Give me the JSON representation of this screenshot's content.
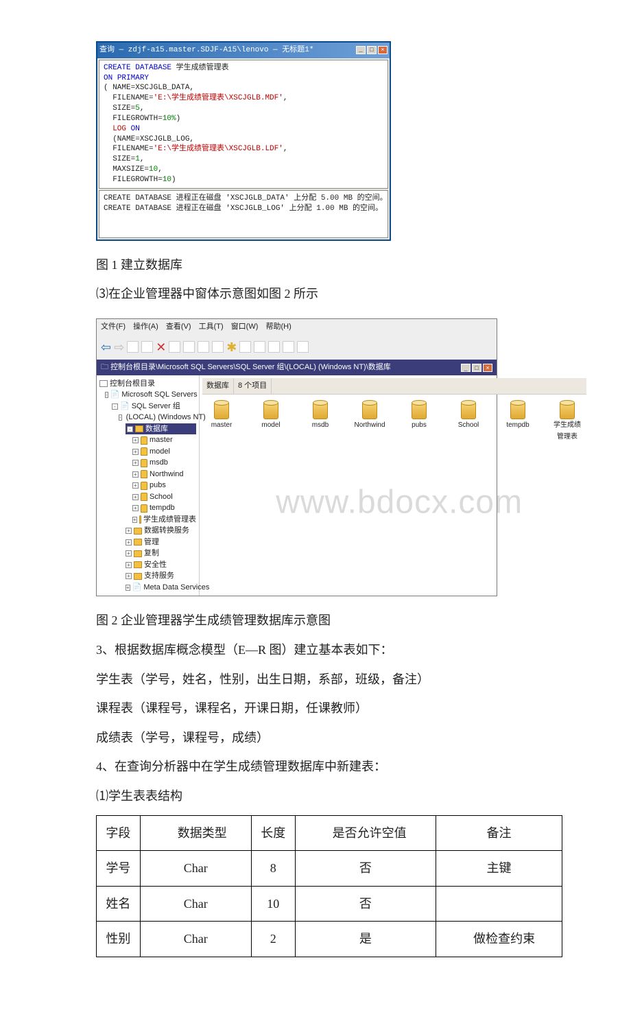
{
  "win1": {
    "title": "查询 — zdjf-a15.master.SDJF-A15\\lenovo — 无标题1*",
    "code": {
      "l1a": "CREATE",
      "l1b": "DATABASE",
      "l1c": "学生成绩管理表",
      "l2a": "ON",
      "l2b": "PRIMARY",
      "l3a": "( NAME=",
      "l3b": "XSCJGLB_DATA,",
      "l4a": "  FILENAME=",
      "l4b": "'E:\\学生成绩管理表\\XSCJGLB.MDF'",
      "l4c": ",",
      "l5a": "  SIZE=",
      "l5b": "5",
      "l5c": ",",
      "l6a": "  FILEGROWTH=",
      "l6b": "10%",
      "l6c": ")",
      "l7a": "LOG",
      "l7b": "ON",
      "l8a": "  (NAME=",
      "l8b": "XSCJGLB_LOG,",
      "l9a": "  FILENAME=",
      "l9b": "'E:\\学生成绩管理表\\XSCJGLB.LDF'",
      "l9c": ",",
      "l10a": "  SIZE=",
      "l10b": "1",
      "l10c": ",",
      "l11a": "  MAXSIZE=",
      "l11b": "10",
      "l11c": ",",
      "l12a": "  FILEGROWTH=",
      "l12b": "10",
      "l12c": ")"
    },
    "msg1": "CREATE DATABASE 进程正在磁盘 'XSCJGLB_DATA' 上分配 5.00 MB 的空间。",
    "msg2": "CREATE DATABASE 进程正在磁盘 'XSCJGLB_LOG' 上分配 1.00 MB 的空间。"
  },
  "cap1": " 图 1 建立数据库",
  "p2": "⑶在企业管理器中窗体示意图如图 2 所示",
  "win2": {
    "menu": [
      "文件(F)",
      "操作(A)",
      "查看(V)",
      "工具(T)",
      "窗口(W)",
      "帮助(H)"
    ],
    "path": "控制台根目录\\Microsoft SQL Servers\\SQL Server 组\\(LOCAL) (Windows NT)\\数据库",
    "tree_root": "控制台根目录",
    "tree_srv": "Microsoft SQL Servers",
    "tree_grp": "SQL Server 组",
    "tree_local": "(LOCAL) (Windows NT)",
    "tree_dbfolder": "数据库",
    "tree_dbs": [
      "master",
      "model",
      "msdb",
      "Northwind",
      "pubs",
      "School",
      "tempdb",
      "学生成绩管理表"
    ],
    "tree_other": [
      "数据转换服务",
      "管理",
      "复制",
      "安全性",
      "支持服务",
      "Meta Data Services"
    ],
    "list_hdr1": "数据库",
    "list_hdr2": "8 个项目",
    "items": [
      "master",
      "model",
      "msdb",
      "Northwind",
      "pubs",
      "School",
      "tempdb",
      "学生成绩管理表"
    ]
  },
  "watermark": "www.bdocx.com",
  "cap2": "图 2 企业管理器学生成绩管理数据库示意图",
  "p3": "3、根据数据库概念模型（E—R 图）建立基本表如下：",
  "p4": "学生表（学号，姓名，性别，出生日期，系部，班级，备注）",
  "p5": " 课程表（课程号，课程名，开课日期，任课教师）",
  "p6": " 成绩表（学号，课程号，成绩）",
  "p7": "4、在查询分析器中在学生成绩管理数据库中新建表：",
  "p8": "⑴学生表表结构",
  "table": {
    "h1": "字段",
    "h2": "数据类型",
    "h3": "长度",
    "h4": "是否允许空值",
    "h5": "备注",
    "r1c1": "学号",
    "r1c2": "Char",
    "r1c3": "8",
    "r1c4": "否",
    "r1c5": "主键",
    "r2c1": "姓名",
    "r2c2": "Char",
    "r2c3": "10",
    "r2c4": "否",
    "r2c5": "",
    "r3c1": "性别",
    "r3c2": "Char",
    "r3c3": "2",
    "r3c4": "是",
    "r3c5": "做检查约束"
  }
}
